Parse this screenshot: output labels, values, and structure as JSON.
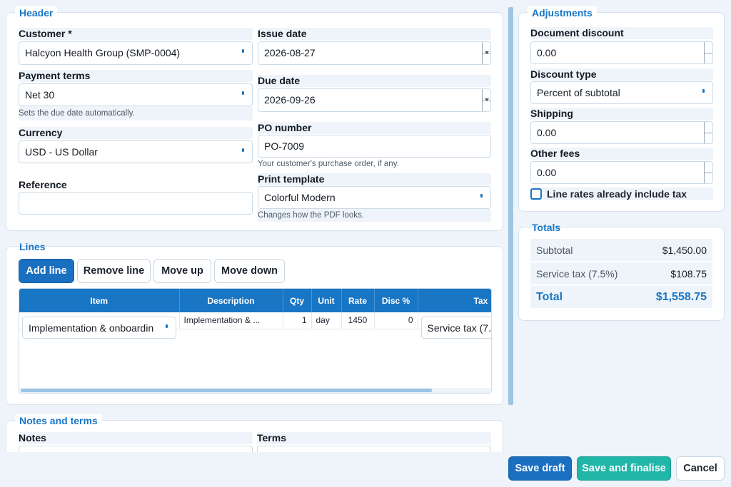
{
  "header_section": {
    "legend": "Header",
    "customer": {
      "label": "Customer *",
      "value": "Halcyon Health Group  (SMP-0004)"
    },
    "issue_date": {
      "label": "Issue date",
      "value": "2026-08-27"
    },
    "payment_terms": {
      "label": "Payment terms",
      "value": "Net 30",
      "hint": "Sets the due date automatically."
    },
    "due_date": {
      "label": "Due date",
      "value": "2026-09-26"
    },
    "currency": {
      "label": "Currency",
      "value": "USD - US Dollar"
    },
    "po_number": {
      "label": "PO number",
      "value": "PO-7009",
      "hint": "Your customer's purchase order, if any."
    },
    "reference": {
      "label": "Reference",
      "value": ""
    },
    "print_template": {
      "label": "Print template",
      "value": "Colorful Modern",
      "hint": "Changes how the PDF looks."
    }
  },
  "lines_section": {
    "legend": "Lines",
    "buttons": {
      "add": "Add line",
      "remove": "Remove line",
      "up": "Move up",
      "down": "Move down"
    },
    "columns": [
      "Item",
      "Description",
      "Qty",
      "Unit",
      "Rate",
      "Disc %",
      "Tax"
    ],
    "rows": [
      {
        "item": "Implementation & onboardin",
        "description": "Implementation & ...",
        "qty": "1",
        "unit": "day",
        "rate": "1450",
        "disc": "0",
        "tax": "Service tax (7."
      }
    ]
  },
  "notes_section": {
    "legend": "Notes and terms",
    "notes_label": "Notes",
    "terms_label": "Terms"
  },
  "adjustments": {
    "legend": "Adjustments",
    "document_discount": {
      "label": "Document discount",
      "value": "0.00"
    },
    "discount_type": {
      "label": "Discount type",
      "value": "Percent of subtotal"
    },
    "shipping": {
      "label": "Shipping",
      "value": "0.00"
    },
    "other_fees": {
      "label": "Other fees",
      "value": "0.00"
    },
    "tax_inclusive": {
      "label": "Line rates already include tax",
      "checked": false
    }
  },
  "totals": {
    "legend": "Totals",
    "subtotal": {
      "label": "Subtotal",
      "value": "$1,450.00"
    },
    "tax": {
      "label": "Service tax (7.5%)",
      "value": "$108.75"
    },
    "total": {
      "label": "Total",
      "value": "$1,558.75"
    }
  },
  "footer": {
    "save_draft": "Save draft",
    "save_finalise": "Save and finalise",
    "cancel": "Cancel"
  },
  "colors": {
    "accent": "#1976c5",
    "teal": "#20b6a8",
    "primary_button": "#1b6fc0"
  }
}
